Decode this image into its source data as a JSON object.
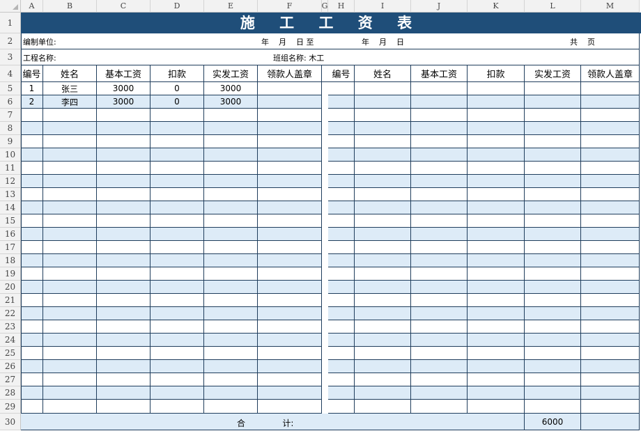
{
  "sheet": {
    "columns": [
      "A",
      "B",
      "C",
      "D",
      "E",
      "F",
      "G",
      "H",
      "I",
      "J",
      "K",
      "L",
      "M"
    ],
    "rows": [
      "1",
      "2",
      "3",
      "4",
      "5",
      "6",
      "7",
      "8",
      "9",
      "10",
      "11",
      "12",
      "13",
      "14",
      "15",
      "16",
      "17",
      "18",
      "19",
      "20",
      "21",
      "22",
      "23",
      "24",
      "25",
      "26",
      "27",
      "28",
      "29",
      "30"
    ]
  },
  "title": "施 工 工 资 表",
  "info": {
    "unit_label": "编制单位:",
    "date_from": "年    月    日 至",
    "date_to": "年    月    日",
    "pages": "共    页",
    "project_label": "工程名称:",
    "team_label": "班组名称: 木工"
  },
  "headers": [
    "编号",
    "姓名",
    "基本工资",
    "扣款",
    "实发工资",
    "领款人盖章"
  ],
  "records": [
    [
      "1",
      "张三",
      "3000",
      "0",
      "3000",
      ""
    ],
    [
      "2",
      "李四",
      "3000",
      "0",
      "3000",
      ""
    ]
  ],
  "footer": {
    "total_label": "合              计:",
    "total_value": "6000"
  },
  "colors": {
    "title_bg": "#1f4e79",
    "alt_row_bg": "#ddebf7",
    "border": "#1f3d5c"
  }
}
